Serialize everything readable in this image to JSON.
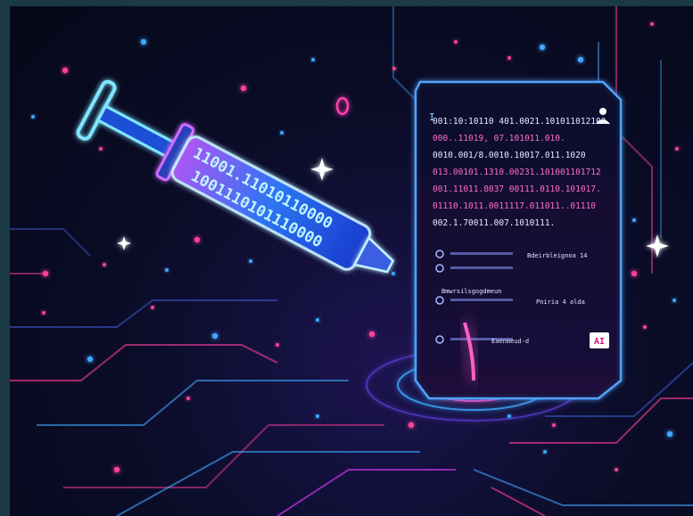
{
  "scene": {
    "description_tags": [
      "syringe-icon",
      "binary-code",
      "document-panel",
      "circuit-board"
    ],
    "colors": {
      "frame": "#1b3a44",
      "background_deep": "#060818",
      "neon_blue": "#3fa9ff",
      "neon_cyan": "#6ff0ff",
      "neon_pink": "#ff3fb4",
      "neon_magenta": "#e23cff"
    }
  },
  "syringe": {
    "binary_row_1": "11001.11010110000",
    "binary_row_2": "1001110101110000"
  },
  "panel": {
    "header_mark": "I",
    "code_lines": [
      "001:10:10110 401.0021.101011012100",
      "000..11019, 07.101011.010.",
      "0010.001/8.0010.10017.011.1020",
      "013.00101.1310.00231.101001101712",
      "001.11011.8037 00111.0110.101017.",
      "01110.1011.0011117.011011..01110",
      "002.1.70011.007.1010111."
    ],
    "row_labels": [
      "Bdeirbleignoa 14",
      "Bmwrsilsgogdmeun",
      "Pniria  4 alda",
      "Eaenmeud-d"
    ],
    "corner_badge": "AI"
  }
}
